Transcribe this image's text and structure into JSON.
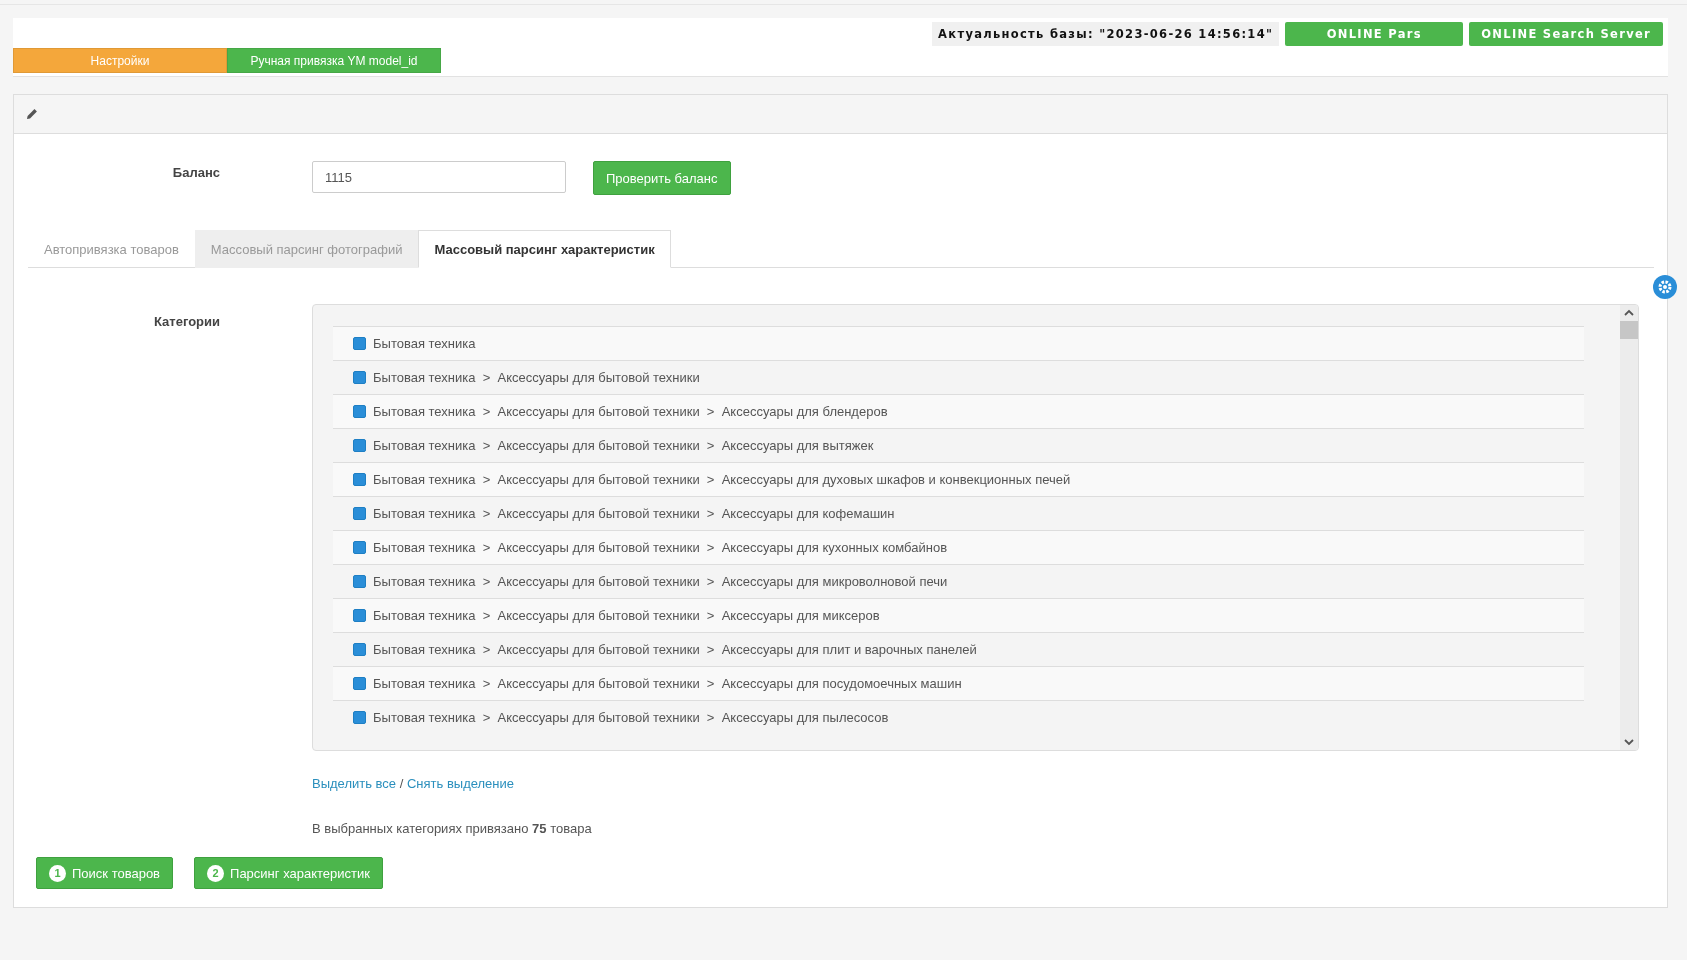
{
  "header": {
    "status": "Актуальность базы: \"2023-06-26 14:56:14\"",
    "badges": [
      "ONLINE Pars",
      "ONLINE Search Server"
    ]
  },
  "nav_tabs": [
    {
      "label": "Настройки",
      "selected": true
    },
    {
      "label": "Ручная привязка YM model_id",
      "selected": false
    }
  ],
  "balance": {
    "label": "Баланс",
    "value": "1115",
    "button": "Проверить баланс"
  },
  "tabs": [
    {
      "label": "Автопривязка товаров",
      "selected": false,
      "disabled": false
    },
    {
      "label": "Массовый парсинг фотографий",
      "selected": false,
      "disabled": true
    },
    {
      "label": "Массовый парсинг характеристик",
      "selected": true,
      "disabled": false
    }
  ],
  "categories": {
    "label": "Категории",
    "items": [
      {
        "label": "Бытовая техника",
        "checked": true
      },
      {
        "label": "Бытовая техника  >  Аксессуары для бытовой техники",
        "checked": true
      },
      {
        "label": "Бытовая техника  >  Аксессуары для бытовой техники  >  Аксессуары для блендеров",
        "checked": true
      },
      {
        "label": "Бытовая техника  >  Аксессуары для бытовой техники  >  Аксессуары для вытяжек",
        "checked": true
      },
      {
        "label": "Бытовая техника  >  Аксессуары для бытовой техники  >  Аксессуары для духовых шкафов и конвекционных печей",
        "checked": true
      },
      {
        "label": "Бытовая техника  >  Аксессуары для бытовой техники  >  Аксессуары для кофемашин",
        "checked": true
      },
      {
        "label": "Бытовая техника  >  Аксессуары для бытовой техники  >  Аксессуары для кухонных комбайнов",
        "checked": true
      },
      {
        "label": "Бытовая техника  >  Аксессуары для бытовой техники  >  Аксессуары для микроволновой печи",
        "checked": true
      },
      {
        "label": "Бытовая техника  >  Аксессуары для бытовой техники  >  Аксессуары для миксеров",
        "checked": true
      },
      {
        "label": "Бытовая техника  >  Аксессуары для бытовой техники  >  Аксессуары для плит и варочных панелей",
        "checked": true
      },
      {
        "label": "Бытовая техника  >  Аксессуары для бытовой техники  >  Аксессуары для посудомоечных машин",
        "checked": true
      },
      {
        "label": "Бытовая техника  >  Аксессуары для бытовой техники  >  Аксессуары для пылесосов",
        "checked": true
      }
    ],
    "select_all": "Выделить все",
    "separator": "/",
    "deselect": "Снять выделение"
  },
  "summary": "В выбранных категориях привязано **75** товара",
  "actions": [
    {
      "number": "1",
      "label": "Поиск товаров"
    },
    {
      "number": "2",
      "label": "Парсинг характеристик"
    }
  ]
}
